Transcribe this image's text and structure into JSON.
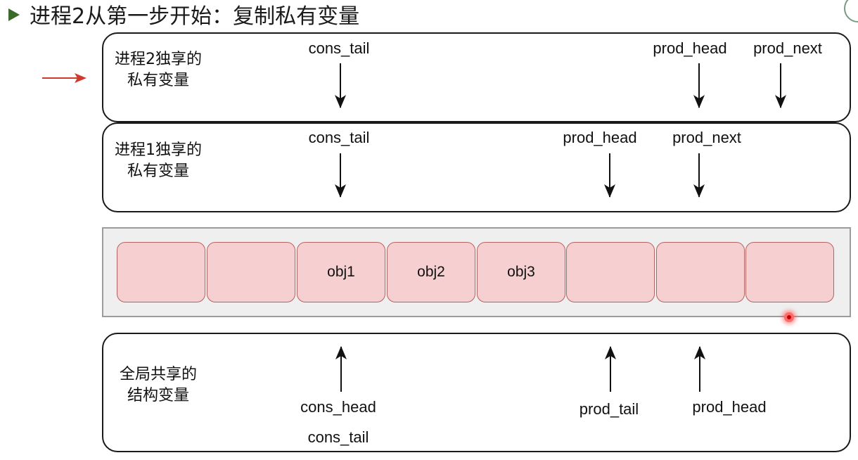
{
  "slide": {
    "title": "进程2从第一步开始：复制私有变量"
  },
  "proc2": {
    "label": "进程2独享的\n私有变量",
    "pointers": [
      "cons_tail",
      "prod_head",
      "prod_next"
    ]
  },
  "proc1": {
    "label": "进程1独享的\n私有变量",
    "pointers": [
      "cons_tail",
      "prod_head",
      "prod_next"
    ]
  },
  "ring": {
    "slots": [
      "",
      "",
      "obj1",
      "obj2",
      "obj3",
      "",
      "",
      ""
    ]
  },
  "global": {
    "label": "全局共享的\n结构变量",
    "pointers": [
      "cons_head",
      "cons_tail",
      "prod_tail",
      "prod_head"
    ]
  },
  "colors": {
    "slot_fill": "#f6d0d0",
    "slot_border": "#b46363",
    "indicator_arrow": "#d03a2c",
    "bullet": "#3a6b2a"
  },
  "icons": [
    "bullet-arrow-icon",
    "indicator-arrow-icon"
  ]
}
